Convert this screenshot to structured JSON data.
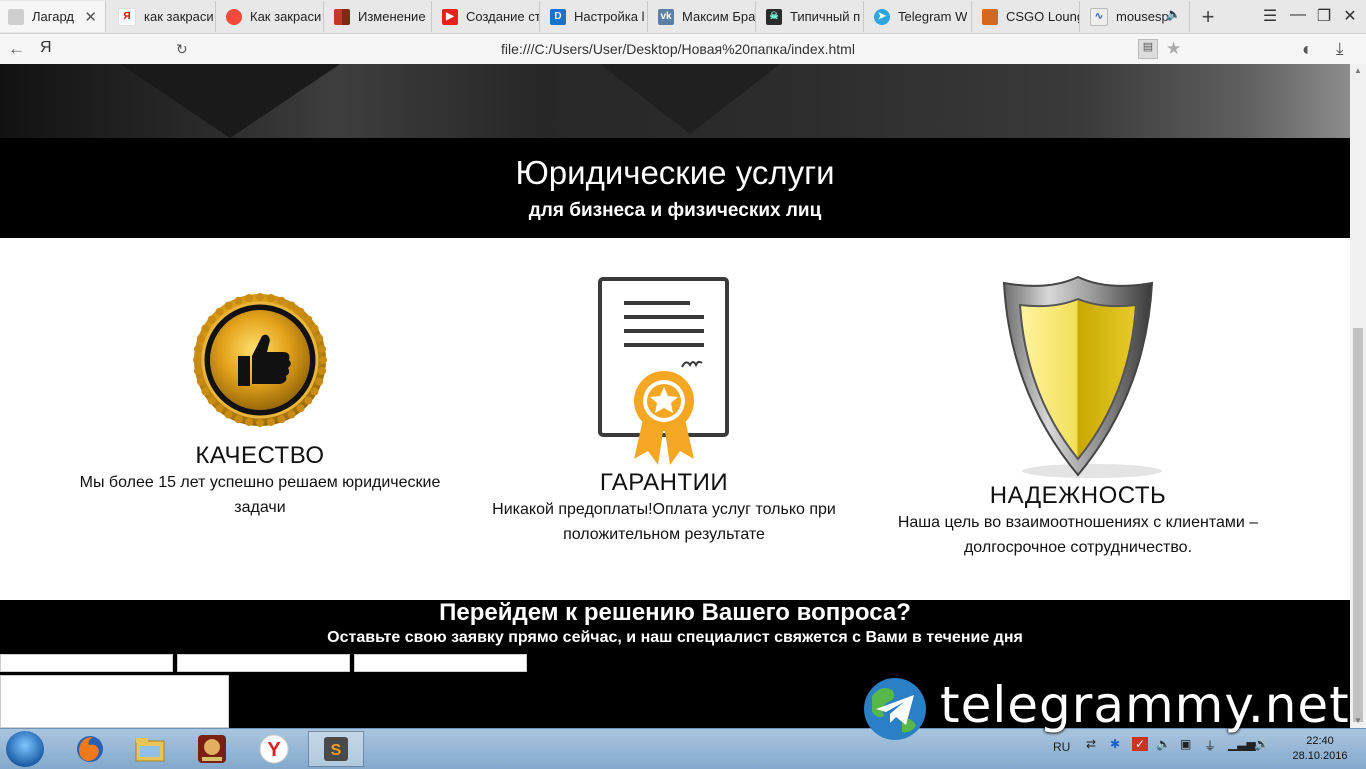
{
  "tabs": [
    {
      "label": "Лагард",
      "active": true,
      "icon": "page-icon"
    },
    {
      "label": "как закраси",
      "icon": "yandex-icon"
    },
    {
      "label": "Как закраси",
      "icon": "red-dot-icon"
    },
    {
      "label": "Изменение",
      "icon": "blocks-icon"
    },
    {
      "label": "Создание ст",
      "icon": "youtube-icon"
    },
    {
      "label": "Настройка l",
      "icon": "d-icon"
    },
    {
      "label": "Максим Бра",
      "icon": "vk-icon"
    },
    {
      "label": "Типичный п",
      "icon": "ghost-icon"
    },
    {
      "label": "Telegram W",
      "icon": "telegram-icon"
    },
    {
      "label": "CSGO Loung",
      "icon": "csgo-icon"
    },
    {
      "label": "mousesp",
      "icon": "chart-icon"
    }
  ],
  "address": {
    "url": "file:///C:/Users/User/Desktop/Новая%20папка/index.html",
    "yandex_letter": "Я"
  },
  "banner": {
    "title": "Юридические услуги",
    "subtitle": "для бизнеса и физических лиц"
  },
  "features": [
    {
      "title": "КАЧЕСТВО",
      "description": "Мы более 15 лет успешно решаем юридические задачи",
      "icon": "thumbs-up-medal-icon"
    },
    {
      "title": "ГАРАНТИИ",
      "description": "Никакой предоплаты!Оплата услуг только при положительном результате",
      "icon": "certificate-icon"
    },
    {
      "title": "НАДЕЖНОСТЬ",
      "description": "Наша цель во взаимоотношениях с клиентами – долгосрочное сотрудничество.",
      "icon": "shield-icon"
    }
  ],
  "cta": {
    "heading": "Перейдем к решению Вашего вопроса?",
    "subheading": "Оставьте свою заявку прямо сейчас, и наш специалист свяжется с Вами в течение дня"
  },
  "taskbar": {
    "apps": [
      "firefox-icon",
      "explorer-icon",
      "game-icon",
      "yandex-browser-icon",
      "sublime-text-icon"
    ],
    "lang": "RU",
    "time": "22:40",
    "date": "28.10.2016"
  },
  "watermark": {
    "text": "telegrammy.net"
  },
  "colors": {
    "banner_bg": "#000000",
    "accent_gold": "#e3a21a",
    "shield_yellow": "#f2e05a"
  }
}
